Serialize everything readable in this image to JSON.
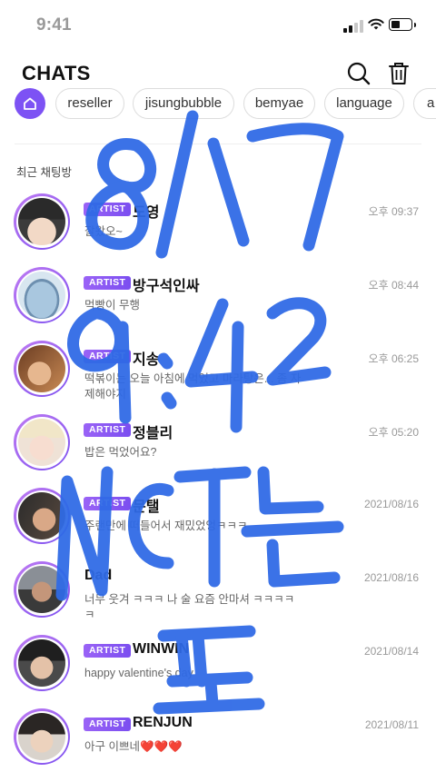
{
  "status_bar": {
    "time": "9:41"
  },
  "header": {
    "title": "CHATS",
    "search_icon": "search-icon",
    "trash_icon": "trash-icon"
  },
  "filters": {
    "home_icon": "home-icon",
    "chips": [
      "reseller",
      "jisungbubble",
      "bemyae",
      "language",
      "a"
    ]
  },
  "section": {
    "label": "최근 채팅방"
  },
  "badge_label": "ARTIST",
  "chats": [
    {
      "name": "도영",
      "time": "오후 09:37",
      "message": "잘왔오~",
      "artist": true
    },
    {
      "name": "방구석인싸",
      "time": "오후 08:44",
      "message": "먹빵이 무행",
      "artist": true
    },
    {
      "name": "지송",
      "time": "오후 06:25",
      "message": "떡볶이는 오늘 아침에 먹었고 마라탕은... 좀 자제해야지",
      "artist": true
    },
    {
      "name": "정블리",
      "time": "오후 05:20",
      "message": "밥은 먹었어요?",
      "artist": true
    },
    {
      "name": "문탤",
      "time": "2021/08/16",
      "message": "주랜만에 떠들어서 재밌었엉ㅋㅋㅋ",
      "artist": true
    },
    {
      "name": "Dad",
      "time": "2021/08/16",
      "message": "너무 웃겨 ㅋㅋㅋ 나 술 요즘 안마셔 ㅋㅋㅋㅋㅋ",
      "artist": false
    },
    {
      "name": "WINWIN",
      "time": "2021/08/14",
      "message": "happy valentine's day",
      "artist": true
    },
    {
      "name": "RENJUN",
      "time": "2021/08/11",
      "message": "아구 이쁘네❤️❤️❤️",
      "artist": true
    }
  ],
  "annotation": {
    "color": "#2f6ae6"
  },
  "colors": {
    "accent": "#7b4ef0",
    "muted": "#999999"
  }
}
